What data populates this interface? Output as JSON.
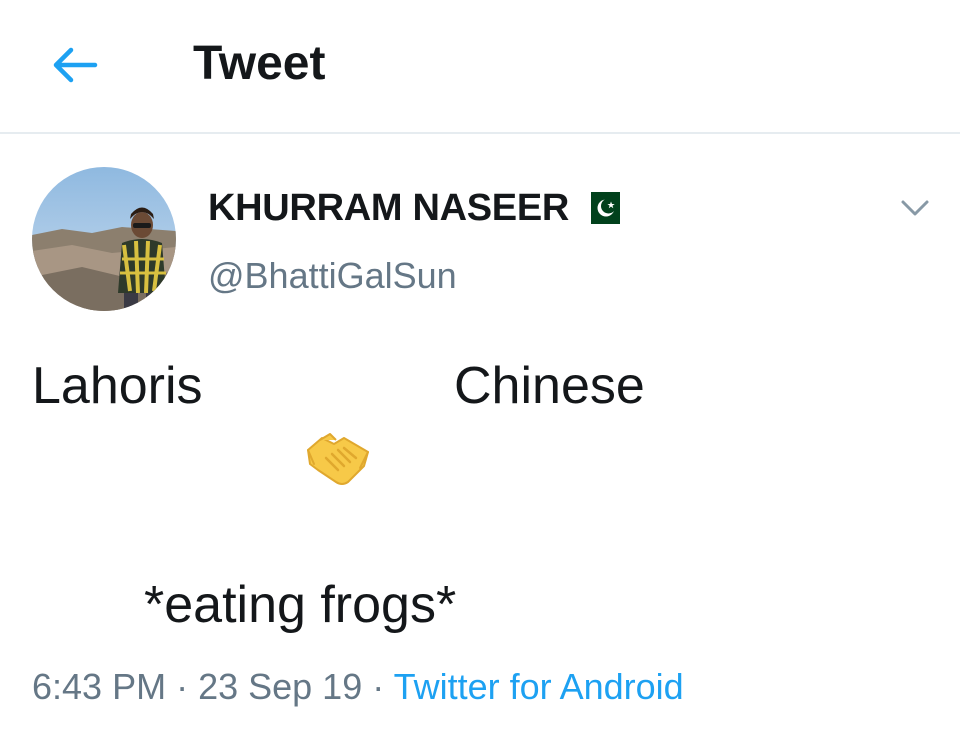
{
  "header": {
    "title": "Tweet",
    "back_icon": "arrow-left-icon",
    "accent_color": "#1da1f2"
  },
  "author": {
    "name": "KHURRAM NASEER",
    "handle": "@BhattiGalSun",
    "flag_icon": "pakistan-flag-icon",
    "menu_icon": "chevron-down-icon"
  },
  "tweet": {
    "line1_left": "Lahoris",
    "line1_right": "Chinese",
    "emoji_icon": "handshake-icon",
    "line2": "*eating frogs*"
  },
  "meta": {
    "time": "6:43 PM",
    "separator": " · ",
    "date": "23 Sep 19",
    "source": "Twitter for Android"
  },
  "colors": {
    "text_primary": "#14171a",
    "text_secondary": "#657786",
    "link": "#1da1f2",
    "divider": "#e6ecf0"
  }
}
